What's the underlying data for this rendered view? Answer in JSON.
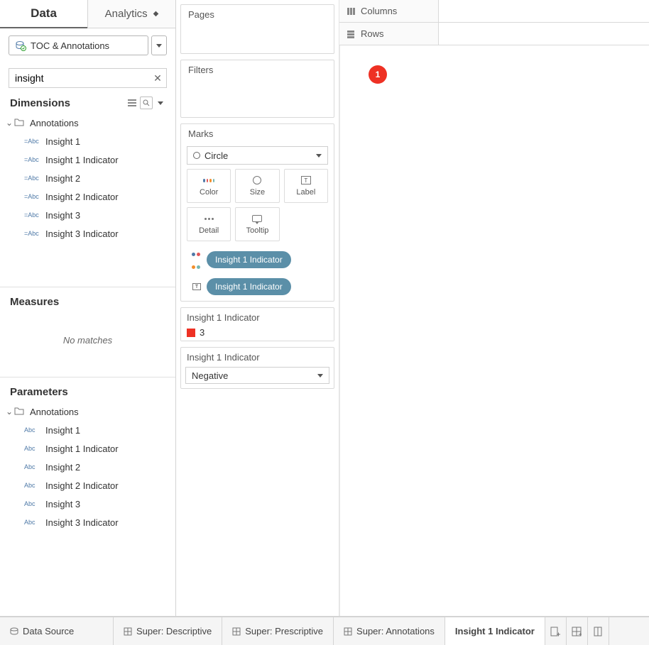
{
  "tabs": {
    "data": "Data",
    "analytics": "Analytics"
  },
  "datasource": {
    "label": "TOC & Annotations"
  },
  "search": {
    "value": "insight"
  },
  "dimensions": {
    "title": "Dimensions",
    "folder": "Annotations",
    "items": [
      {
        "type": "=Abc",
        "label": "Insight 1"
      },
      {
        "type": "=Abc",
        "label": "Insight 1 Indicator"
      },
      {
        "type": "=Abc",
        "label": "Insight 2"
      },
      {
        "type": "=Abc",
        "label": "Insight 2 Indicator"
      },
      {
        "type": "=Abc",
        "label": "Insight 3"
      },
      {
        "type": "=Abc",
        "label": "Insight 3 Indicator"
      }
    ]
  },
  "measures": {
    "title": "Measures",
    "nomatch": "No matches"
  },
  "parameters": {
    "title": "Parameters",
    "folder": "Annotations",
    "items": [
      {
        "type": "Abc",
        "label": "Insight 1"
      },
      {
        "type": "Abc",
        "label": "Insight 1 Indicator"
      },
      {
        "type": "Abc",
        "label": "Insight 2"
      },
      {
        "type": "Abc",
        "label": "Insight 2 Indicator"
      },
      {
        "type": "Abc",
        "label": "Insight 3"
      },
      {
        "type": "Abc",
        "label": "Insight 3 Indicator"
      }
    ]
  },
  "cards": {
    "pages": "Pages",
    "filters": "Filters",
    "marks": {
      "title": "Marks",
      "type": "Circle",
      "cells": {
        "color": "Color",
        "size": "Size",
        "label": "Label",
        "detail": "Detail",
        "tooltip": "Tooltip"
      },
      "pills": [
        {
          "mark": "color",
          "label": "Insight 1 Indicator"
        },
        {
          "mark": "label",
          "label": "Insight 1 Indicator"
        }
      ]
    },
    "colorLegend": {
      "title": "Insight 1 Indicator",
      "swatch_value": "3"
    },
    "highlighter": {
      "title": "Insight 1 Indicator",
      "value": "Negative"
    }
  },
  "shelves": {
    "columns": "Columns",
    "rows": "Rows"
  },
  "view": {
    "badge": "1"
  },
  "bottom": {
    "datasource": "Data Source",
    "tabs": [
      {
        "label": "Super: Descriptive",
        "type": "dash"
      },
      {
        "label": "Super: Prescriptive",
        "type": "dash"
      },
      {
        "label": "Super: Annotations",
        "type": "dash"
      },
      {
        "label": "Insight 1 Indicator",
        "type": "sheet",
        "active": true
      }
    ]
  }
}
